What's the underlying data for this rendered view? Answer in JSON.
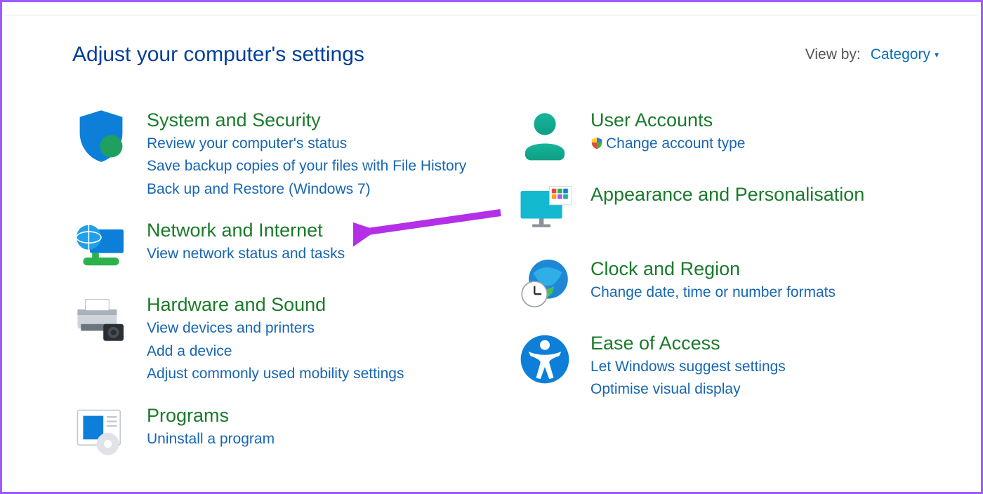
{
  "header": {
    "title": "Adjust your computer's settings",
    "viewby_label": "View by:",
    "viewby_value": "Category"
  },
  "left": [
    {
      "id": "system-security",
      "title": "System and Security",
      "links": [
        "Review your computer's status",
        "Save backup copies of your files with File History",
        "Back up and Restore (Windows 7)"
      ]
    },
    {
      "id": "network-internet",
      "title": "Network and Internet",
      "links": [
        "View network status and tasks"
      ]
    },
    {
      "id": "hardware-sound",
      "title": "Hardware and Sound",
      "links": [
        "View devices and printers",
        "Add a device",
        "Adjust commonly used mobility settings"
      ]
    },
    {
      "id": "programs",
      "title": "Programs",
      "links": [
        "Uninstall a program"
      ]
    }
  ],
  "right": [
    {
      "id": "user-accounts",
      "title": "User Accounts",
      "links": [
        "Change account type"
      ],
      "link_shield": [
        true
      ]
    },
    {
      "id": "appearance",
      "title": "Appearance and Personalisation",
      "links": []
    },
    {
      "id": "clock-region",
      "title": "Clock and Region",
      "links": [
        "Change date, time or number formats"
      ]
    },
    {
      "id": "ease-of-access",
      "title": "Ease of Access",
      "links": [
        "Let Windows suggest settings",
        "Optimise visual display"
      ]
    }
  ]
}
